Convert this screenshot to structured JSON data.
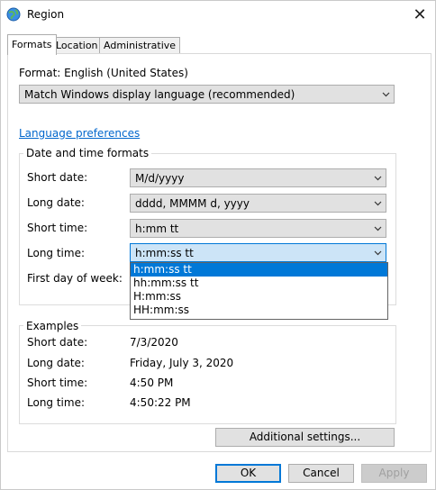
{
  "window": {
    "title": "Region",
    "close_glyph": "✕"
  },
  "tabs": [
    {
      "label": "Formats",
      "active": true
    },
    {
      "label": "Location",
      "active": false
    },
    {
      "label": "Administrative",
      "active": false
    }
  ],
  "format": {
    "label": "Format: English (United States)",
    "value": "Match Windows display language (recommended)"
  },
  "language_link": "Language preferences",
  "datetime_group": {
    "title": "Date and time formats",
    "short_date": {
      "label": "Short date:",
      "value": "M/d/yyyy"
    },
    "long_date": {
      "label": "Long date:",
      "value": "dddd, MMMM d, yyyy"
    },
    "short_time": {
      "label": "Short time:",
      "value": "h:mm tt"
    },
    "long_time": {
      "label": "Long time:",
      "value": "h:mm:ss tt"
    },
    "first_day": {
      "label": "First day of week:"
    }
  },
  "long_time_options": [
    "h:mm:ss tt",
    "hh:mm:ss tt",
    "H:mm:ss",
    "HH:mm:ss"
  ],
  "examples": {
    "title": "Examples",
    "short_date": {
      "label": "Short date:",
      "value": "7/3/2020"
    },
    "long_date": {
      "label": "Long date:",
      "value": "Friday, July 3, 2020"
    },
    "short_time": {
      "label": "Short time:",
      "value": "4:50 PM"
    },
    "long_time": {
      "label": "Long time:",
      "value": "4:50:22 PM"
    }
  },
  "buttons": {
    "additional": "Additional settings...",
    "ok": "OK",
    "cancel": "Cancel",
    "apply": "Apply"
  },
  "colors": {
    "accent": "#0078d7",
    "link": "#0066cc"
  },
  "icons": {
    "title_icon": "globe-icon",
    "dropdown": "chevron-down-icon"
  }
}
